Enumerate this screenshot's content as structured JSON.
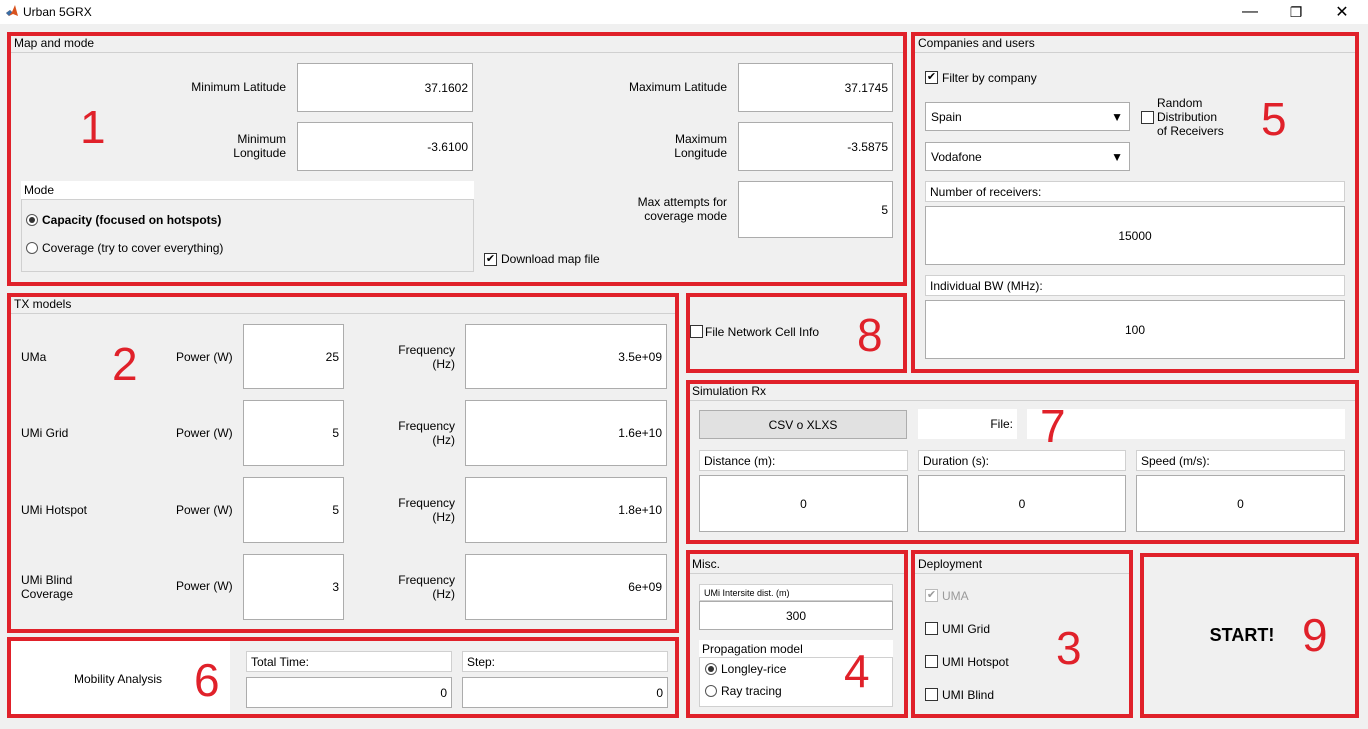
{
  "window": {
    "title": "Urban 5GRX",
    "minimize": "—",
    "restore": "❐",
    "close": "✕"
  },
  "map_mode": {
    "title": "Map and mode",
    "number": "1",
    "min_lat_label": "Minimum Latitude",
    "min_lat": "37.1602",
    "max_lat_label": "Maximum Latitude",
    "max_lat": "37.1745",
    "min_lon_label1": "Minimum",
    "min_lon_label2": "Longitude",
    "min_lon": "-3.6100",
    "max_lon_label1": "Maximum",
    "max_lon_label2": "Longitude",
    "max_lon": "-3.5875",
    "max_attempts_label1": "Max attempts for",
    "max_attempts_label2": "coverage mode",
    "max_attempts": "5",
    "mode_title": "Mode",
    "mode_capacity": "Capacity (focused on hotspots)",
    "mode_coverage": "Coverage (try to cover everything)",
    "download_map": "Download map file"
  },
  "tx_models": {
    "title": "TX models",
    "number": "2",
    "rows": [
      {
        "name1": "UMa",
        "name2": "",
        "power_label": "Power (W)",
        "power": "25",
        "freq_label1": "Frequency",
        "freq_label2": "(Hz)",
        "freq": "3.5e+09"
      },
      {
        "name1": "UMi Grid",
        "name2": "",
        "power_label": "Power (W)",
        "power": "5",
        "freq_label1": "Frequency",
        "freq_label2": "(Hz)",
        "freq": "1.6e+10"
      },
      {
        "name1": "UMi Hotspot",
        "name2": "",
        "power_label": "Power (W)",
        "power": "5",
        "freq_label1": "Frequency",
        "freq_label2": "(Hz)",
        "freq": "1.8e+10"
      },
      {
        "name1": "UMi Blind",
        "name2": "Coverage",
        "power_label": "Power (W)",
        "power": "3",
        "freq_label1": "Frequency",
        "freq_label2": "(Hz)",
        "freq": "6e+09"
      }
    ]
  },
  "mobility": {
    "number": "6",
    "label": "Mobility Analysis",
    "total_time_label": "Total Time:",
    "total_time": "0",
    "step_label": "Step:",
    "step": "0"
  },
  "file_network": {
    "number": "8",
    "label": "File Network Cell Info"
  },
  "companies": {
    "title": "Companies and users",
    "number": "5",
    "filter_label": "Filter by company",
    "country": "Spain",
    "operator": "Vodafone",
    "random_label1": "Random",
    "random_label2": "Distribution",
    "random_label3": "of Receivers",
    "receivers_label": "Number of receivers:",
    "receivers": "15000",
    "bw_label": "Individual BW (MHz):",
    "bw": "100",
    "chevron": "▼"
  },
  "simulation": {
    "title": "Simulation Rx",
    "number": "7",
    "csv_button": "CSV o XLXS",
    "file_label": "File:",
    "file_value": "",
    "distance_label": "Distance (m):",
    "distance": "0",
    "duration_label": "Duration (s):",
    "duration": "0",
    "speed_label": "Speed (m/s):",
    "speed": "0"
  },
  "misc": {
    "title": "Misc.",
    "number": "4",
    "intersite_label": "UMi Intersite dist. (m)",
    "intersite": "300",
    "prop_title": "Propagation model",
    "prop_longley": "Longley-rice",
    "prop_ray": "Ray tracing"
  },
  "deployment": {
    "title": "Deployment",
    "number": "3",
    "uma": "UMA",
    "umi_grid": "UMI Grid",
    "umi_hotspot": "UMI Hotspot",
    "umi_blind": "UMI Blind"
  },
  "start": {
    "label": "START!",
    "number": "9"
  },
  "colors": {
    "annotation_red": "#e0212a",
    "panel_bg": "#f0f0f0"
  }
}
